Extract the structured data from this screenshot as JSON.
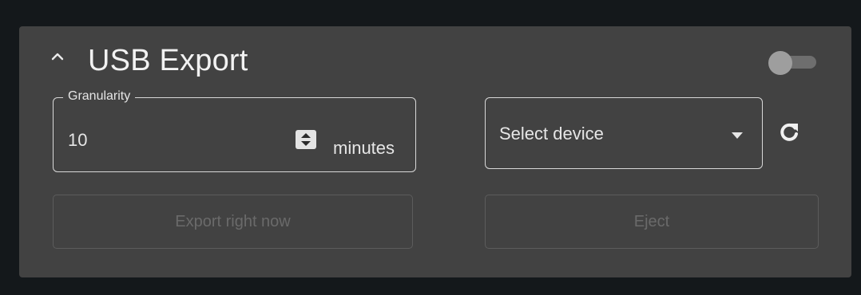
{
  "panel": {
    "title": "USB Export",
    "enabled": false
  },
  "granularity": {
    "label": "Granularity",
    "value": "10",
    "unit": "minutes"
  },
  "device_select": {
    "placeholder": "Select device"
  },
  "buttons": {
    "export_label": "Export right now",
    "eject_label": "Eject"
  },
  "icons": {
    "collapse": "chevron-up-icon",
    "spinner": "spinner-updown-icon",
    "caret": "caret-down-icon",
    "refresh": "refresh-icon"
  },
  "colors": {
    "background": "#14181b",
    "panel": "#424242",
    "text": "#e6e6e6",
    "disabled_text": "#6a6a6a"
  }
}
